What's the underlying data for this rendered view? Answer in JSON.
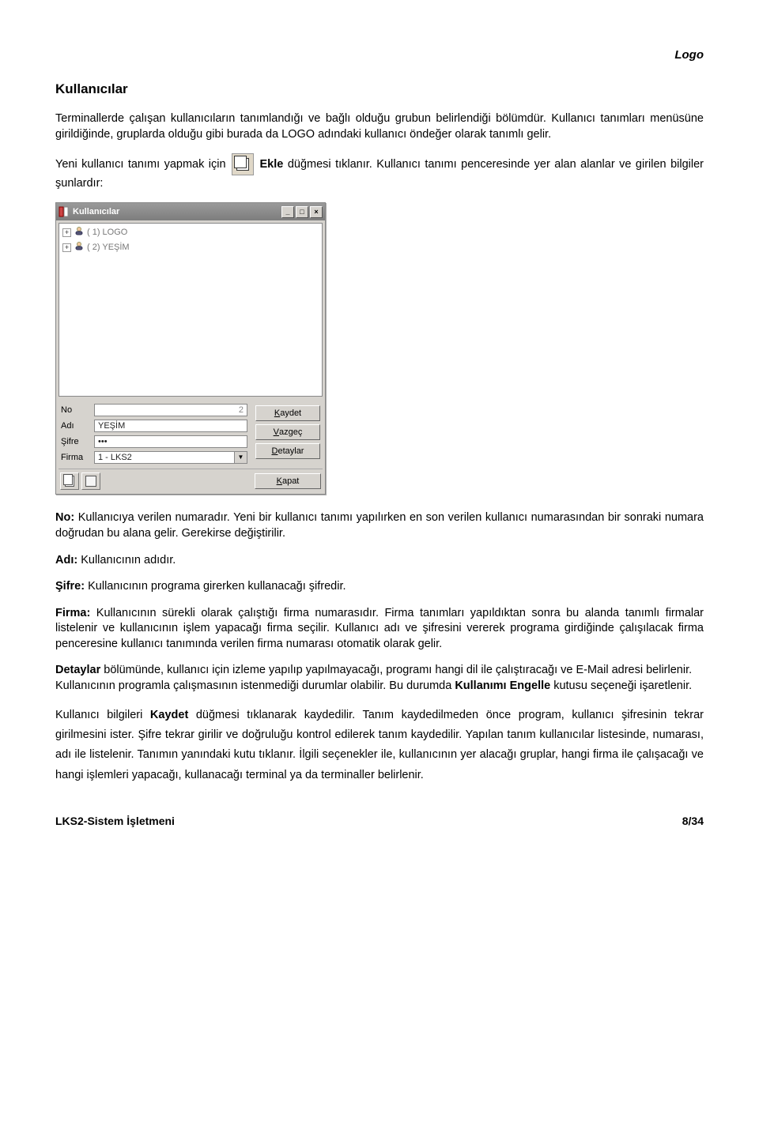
{
  "header": {
    "logo": "Logo"
  },
  "title": "Kullanıcılar",
  "intro1": "Terminallerde çalışan kullanıcıların tanımlandığı ve bağlı olduğu grubun belirlendiği bölümdür. Kullanıcı tanımları menüsüne girildiğinde, gruplarda olduğu gibi burada da LOGO adındaki kullanıcı öndeğer olarak tanımlı gelir.",
  "intro2_a": "Yeni kullanıcı tanımı yapmak için ",
  "intro2_b": " Ekle",
  "intro2_c": " düğmesi tıklanır. Kullanıcı tanımı penceresinde yer alan alanlar ve girilen bilgiler şunlardır:",
  "window": {
    "title": "Kullanıcılar",
    "tree": [
      {
        "label": "( 1) LOGO"
      },
      {
        "label": "( 2) YEŞİM"
      }
    ],
    "form": {
      "no_label": "No",
      "no_value": "2",
      "adi_label": "Adı",
      "adi_value": "YEŞİM",
      "sifre_label": "Şifre",
      "sifre_value": "•••",
      "firma_label": "Firma",
      "firma_value": "1 - LKS2"
    },
    "buttons": {
      "kaydet": "Kaydet",
      "vazgec": "Vazgeç",
      "detaylar": "Detaylar",
      "kapat": "Kapat"
    }
  },
  "defs": {
    "no_label": "No:",
    "no_text": " Kullanıcıya verilen numaradır. Yeni bir kullanıcı tanımı yapılırken en son verilen kullanıcı numarasından bir sonraki numara doğrudan bu alana gelir. Gerekirse değiştirilir.",
    "adi_label": "Adı:",
    "adi_text": " Kullanıcının adıdır.",
    "sifre_label": "Şifre:",
    "sifre_text": " Kullanıcının programa girerken kullanacağı şifredir.",
    "firma_label": "Firma:",
    "firma_text": " Kullanıcının sürekli olarak çalıştığı firma numarasıdır. Firma tanımları yapıldıktan sonra bu alanda tanımlı firmalar listelenir ve kullanıcının işlem yapacağı firma seçilir. Kullanıcı adı ve şifresini vererek programa girdiğinde çalışılacak firma penceresine kullanıcı tanımında verilen firma numarası otomatik olarak gelir.",
    "detay_label": "Detaylar",
    "detay_text_a": " bölümünde, kullanıcı için izleme yapılıp yapılmayacağı, programı hangi dil ile çalıştıracağı ve E-Mail adresi belirlenir.",
    "engelle_a": "Kullanıcının programla çalışmasının istenmediği durumlar olabilir. Bu durumda ",
    "engelle_label": "Kullanımı Engelle",
    "engelle_b": " kutusu seçeneği işaretlenir.",
    "kaydet_a": "Kullanıcı bilgileri  ",
    "kaydet_label": "Kaydet",
    "kaydet_b": " düğmesi tıklanarak kaydedilir. Tanım kaydedilmeden önce program, kullanıcı şifresinin tekrar girilmesini ister. Şifre tekrar girilir ve doğruluğu kontrol edilerek tanım kaydedilir. Yapılan tanım kullanıcılar listesinde, numarası, adı ile listelenir. Tanımın yanındaki kutu tıklanır. İlgili seçenekler ile, kullanıcının yer alacağı gruplar, hangi firma ile çalışacağı ve hangi işlemleri yapacağı, kullanacağı terminal ya da terminaller belirlenir."
  },
  "footer": {
    "left": "LKS2-Sistem İşletmeni",
    "right": "8/34"
  }
}
